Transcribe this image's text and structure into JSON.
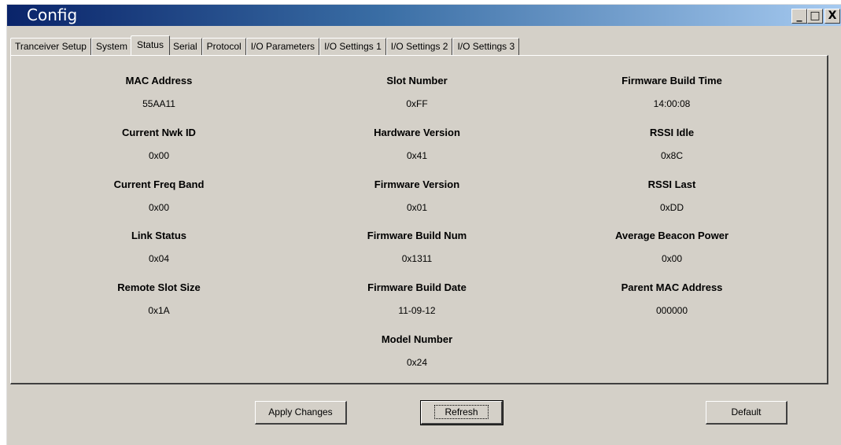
{
  "window": {
    "title": "Config",
    "minimize_label": "_",
    "maximize_label": "□",
    "close_label": "X"
  },
  "tabs": [
    {
      "label": "Tranceiver Setup",
      "active": false
    },
    {
      "label": "System",
      "active": false
    },
    {
      "label": "Status",
      "active": true
    },
    {
      "label": "Serial",
      "active": false
    },
    {
      "label": "Protocol",
      "active": false
    },
    {
      "label": "I/O Parameters",
      "active": false
    },
    {
      "label": "I/O Settings 1",
      "active": false
    },
    {
      "label": "I/O Settings 2",
      "active": false
    },
    {
      "label": "I/O Settings 3",
      "active": false
    }
  ],
  "status": {
    "mac_address": {
      "label": "MAC Address",
      "value": "55AA11"
    },
    "current_nwk_id": {
      "label": "Current Nwk ID",
      "value": "0x00"
    },
    "current_freq_band": {
      "label": "Current Freq Band",
      "value": "0x00"
    },
    "link_status": {
      "label": "Link Status",
      "value": "0x04"
    },
    "remote_slot_size": {
      "label": "Remote Slot Size",
      "value": "0x1A"
    },
    "slot_number": {
      "label": "Slot Number",
      "value": "0xFF"
    },
    "hardware_version": {
      "label": "Hardware Version",
      "value": "0x41"
    },
    "firmware_version": {
      "label": "Firmware Version",
      "value": "0x01"
    },
    "firmware_build_num": {
      "label": "Firmware Build Num",
      "value": "0x1311"
    },
    "firmware_build_date": {
      "label": "Firmware Build Date",
      "value": "11-09-12"
    },
    "model_number": {
      "label": "Model Number",
      "value": "0x24"
    },
    "firmware_build_time": {
      "label": "Firmware Build Time",
      "value": "14:00:08"
    },
    "rssi_idle": {
      "label": "RSSI Idle",
      "value": "0x8C"
    },
    "rssi_last": {
      "label": "RSSI Last",
      "value": "0xDD"
    },
    "average_beacon_power": {
      "label": "Average Beacon Power",
      "value": "0x00"
    },
    "parent_mac_address": {
      "label": "Parent MAC Address",
      "value": "000000"
    }
  },
  "buttons": {
    "apply_label": "Apply Changes",
    "refresh_label": "Refresh",
    "default_label": "Default"
  }
}
